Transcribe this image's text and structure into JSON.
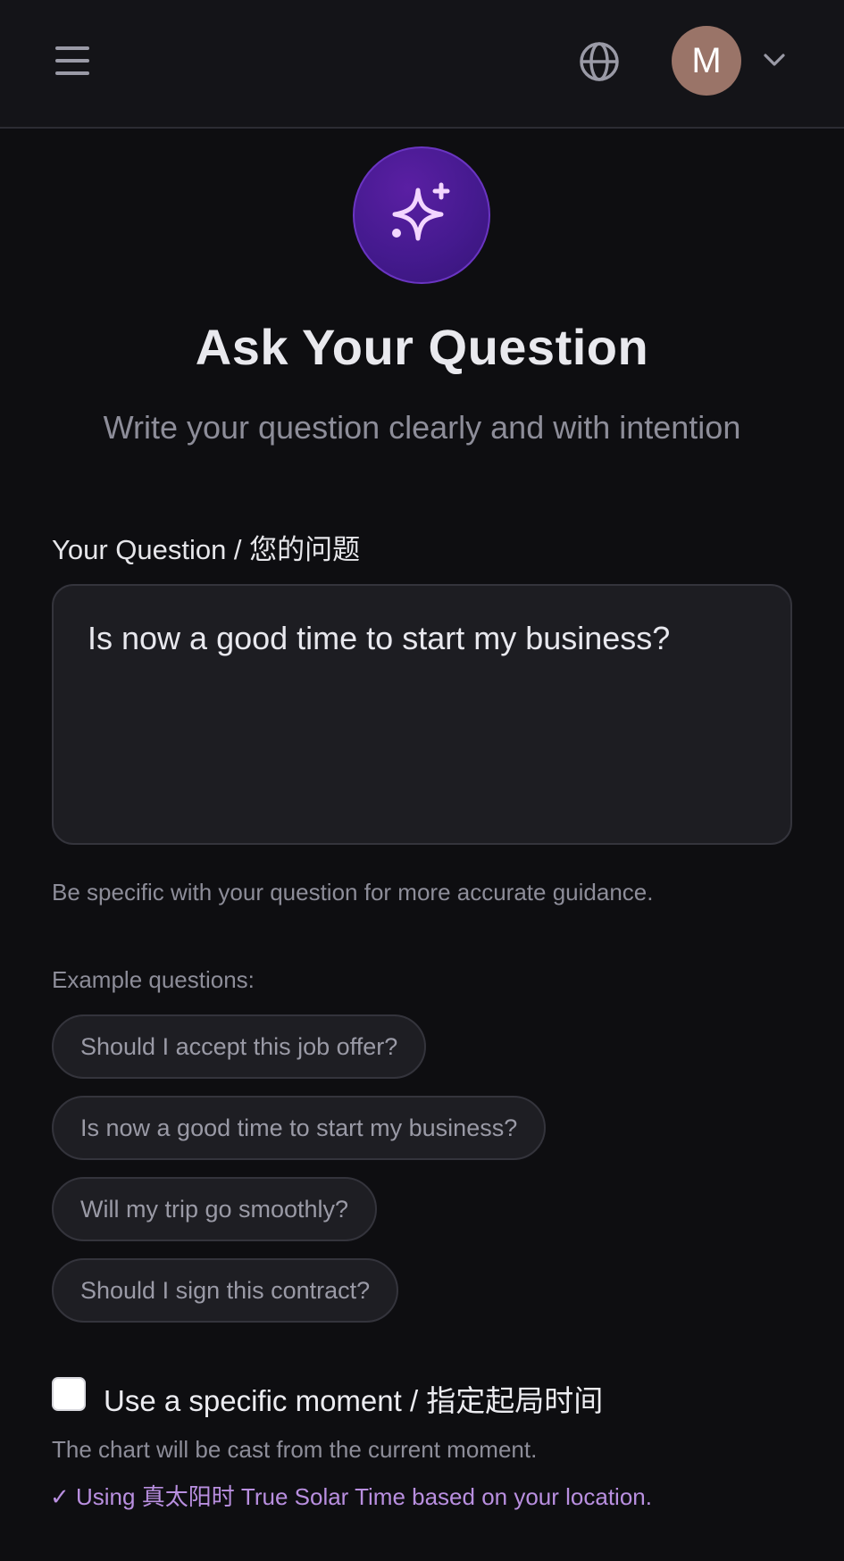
{
  "header": {
    "avatar_initial": "M"
  },
  "hero": {
    "icon": "sparkles-icon",
    "title": "Ask Your Question",
    "subtitle": "Write your question clearly and with intention"
  },
  "form": {
    "label": "Your Question / 您的问题",
    "question_value": "Is now a good time to start my business?",
    "hint": "Be specific with your question for more accurate guidance."
  },
  "examples": {
    "label": "Example questions:",
    "items": [
      "Should I accept this job offer?",
      "Is now a good time to start my business?",
      "Will my trip go smoothly?",
      "Should I sign this contract?"
    ]
  },
  "moment": {
    "checkbox_label": "Use a specific moment / 指定起局时间",
    "checked": false,
    "cast_note": "The chart will be cast from the current moment.",
    "solar_note": "✓ Using 真太阳时 True Solar Time based on your location."
  },
  "colors": {
    "background": "#0e0e11",
    "accent": "#451a8f",
    "solar_note": "#b98fe0"
  }
}
